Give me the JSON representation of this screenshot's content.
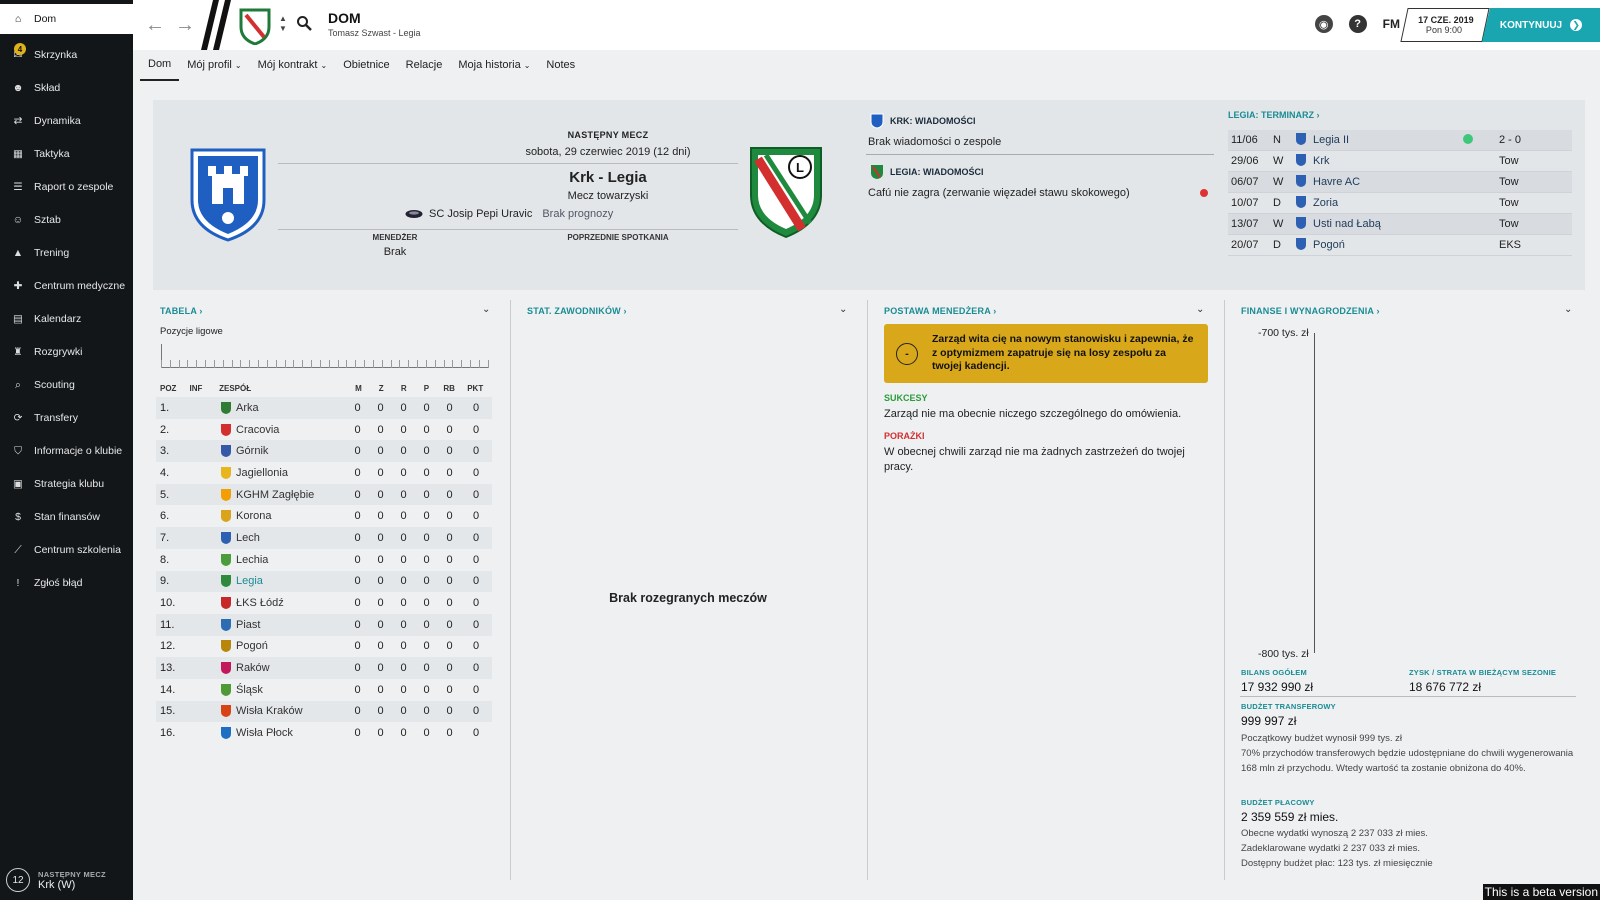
{
  "sidebar": {
    "items": [
      {
        "label": "Dom",
        "icon": "home-icon",
        "active": true
      },
      {
        "label": "Skrzynka",
        "icon": "inbox-icon",
        "badge": "4"
      },
      {
        "label": "Skład",
        "icon": "squad-icon"
      },
      {
        "label": "Dynamika",
        "icon": "dynamics-icon"
      },
      {
        "label": "Taktyka",
        "icon": "tactics-icon"
      },
      {
        "label": "Raport o zespole",
        "icon": "report-icon"
      },
      {
        "label": "Sztab",
        "icon": "staff-icon"
      },
      {
        "label": "Trening",
        "icon": "training-icon"
      },
      {
        "label": "Centrum medyczne",
        "icon": "medical-icon"
      },
      {
        "label": "Kalendarz",
        "icon": "calendar-icon"
      },
      {
        "label": "Rozgrywki",
        "icon": "trophy-icon"
      },
      {
        "label": "Scouting",
        "icon": "scouting-icon"
      },
      {
        "label": "Transfery",
        "icon": "transfers-icon"
      },
      {
        "label": "Informacje o klubie",
        "icon": "club-info-icon"
      },
      {
        "label": "Strategia klubu",
        "icon": "strategy-icon"
      },
      {
        "label": "Stan finansów",
        "icon": "finances-icon"
      },
      {
        "label": "Centrum szkolenia",
        "icon": "academy-icon"
      },
      {
        "label": "Zgłoś błąd",
        "icon": "bug-report-icon"
      }
    ],
    "next_match": {
      "label": "NASTĘPNY MECZ",
      "number": "12",
      "value": "Krk (W)"
    }
  },
  "header": {
    "title": "DOM",
    "subtitle": "Tomasz Szwast - Legia",
    "fm_label": "FM",
    "date": "17 CZE. 2019",
    "time": "Pon 9:00",
    "continue_label": "KONTYNUUJ"
  },
  "tabs": [
    {
      "label": "Dom",
      "active": true,
      "dropdown": false
    },
    {
      "label": "Mój profil",
      "dropdown": true
    },
    {
      "label": "Mój kontrakt",
      "dropdown": true
    },
    {
      "label": "Obietnice",
      "dropdown": false
    },
    {
      "label": "Relacje",
      "dropdown": false
    },
    {
      "label": "Moja historia",
      "dropdown": true
    },
    {
      "label": "Notes",
      "dropdown": false
    }
  ],
  "next_match": {
    "title": "NASTĘPNY MECZ",
    "date": "sobota, 29 czerwiec 2019 (12 dni)",
    "match": "Krk - Legia",
    "type": "Mecz towarzyski",
    "stadium": "SC Josip Pepi Uravic",
    "prognosis": "Brak prognozy",
    "manager_label": "MENEDŻER",
    "manager_value": "Brak",
    "previous_label": "POPRZEDNIE SPOTKANIA"
  },
  "news": {
    "krk_head": "KRK: WIADOMOŚCI",
    "krk_text": "Brak wiadomości o zespole",
    "legia_head": "LEGIA: WIADOMOŚCI",
    "legia_text": "Cafú nie zagra (zerwanie więzadeł stawu skokowego)"
  },
  "fixtures": {
    "head": "LEGIA: TERMINARZ",
    "rows": [
      {
        "date": "11/06",
        "ha": "N",
        "team": "Legia II",
        "result": "2 - 0",
        "dot": true
      },
      {
        "date": "29/06",
        "ha": "W",
        "team": "Krk",
        "result": "Tow"
      },
      {
        "date": "06/07",
        "ha": "W",
        "team": "Havre AC",
        "result": "Tow"
      },
      {
        "date": "10/07",
        "ha": "D",
        "team": "Zoria",
        "result": "Tow"
      },
      {
        "date": "13/07",
        "ha": "W",
        "team": "Usti nad Łabą",
        "result": "Tow"
      },
      {
        "date": "20/07",
        "ha": "D",
        "team": "Pogoń",
        "result": "EKS"
      }
    ]
  },
  "table_widget": {
    "head": "TABELA",
    "sub": "Pozycje ligowe",
    "columns": [
      "POZ",
      "INF",
      "ZESPÓŁ",
      "M",
      "Z",
      "R",
      "P",
      "RB",
      "PKT"
    ],
    "rows": [
      {
        "pos": "1.",
        "team": "Arka",
        "color": "#2f7d32"
      },
      {
        "pos": "2.",
        "team": "Cracovia",
        "color": "#d32f2f"
      },
      {
        "pos": "3.",
        "team": "Górnik",
        "color": "#3557a8"
      },
      {
        "pos": "4.",
        "team": "Jagiellonia",
        "color": "#e8b51c"
      },
      {
        "pos": "5.",
        "team": "KGHM Zagłębie",
        "color": "#f29f05"
      },
      {
        "pos": "6.",
        "team": "Korona",
        "color": "#d9a31a"
      },
      {
        "pos": "7.",
        "team": "Lech",
        "color": "#2d5fb3"
      },
      {
        "pos": "8.",
        "team": "Lechia",
        "color": "#4a9d3a"
      },
      {
        "pos": "9.",
        "team": "Legia",
        "color": "#2e8b3e",
        "highlight": true
      },
      {
        "pos": "10.",
        "team": "ŁKS Łódź",
        "color": "#c62828"
      },
      {
        "pos": "11.",
        "team": "Piast",
        "color": "#2b6cb3"
      },
      {
        "pos": "12.",
        "team": "Pogoń",
        "color": "#b8860b"
      },
      {
        "pos": "13.",
        "team": "Raków",
        "color": "#c2185b"
      },
      {
        "pos": "14.",
        "team": "Śląsk",
        "color": "#4f9a35"
      },
      {
        "pos": "15.",
        "team": "Wisła Kraków",
        "color": "#d84315"
      },
      {
        "pos": "16.",
        "team": "Wisła Płock",
        "color": "#1e6fc1"
      }
    ],
    "zero": "0"
  },
  "player_stats": {
    "head": "STAT. ZAWODNIKÓW",
    "empty": "Brak rozegranych meczów"
  },
  "manager_stance": {
    "head": "POSTAWA MENEDŻERA",
    "board_text": "Zarząd wita cię na nowym stanowisku i zapewnia, że z optymizmem zapatruje się na losy zespołu za twojej kadencji.",
    "mood_symbol": "-",
    "success_label": "SUKCESY",
    "success_text": "Zarząd nie ma obecnie niczego szczególnego do omówienia.",
    "fail_label": "PORAŻKI",
    "fail_text": "W obecnej chwili zarząd nie ma żadnych zastrzeżeń do twojej pracy."
  },
  "finances": {
    "head": "FINANSE I WYNAGRODZENIA",
    "axis_top": "-700 tys. zł",
    "axis_bottom": "-800 tys. zł",
    "balance_label": "BILANS OGÓŁEM",
    "balance_value": "17 932 990 zł",
    "profit_label": "ZYSK / STRATA W BIEŻĄCYM SEZONIE",
    "profit_value": "18 676 772 zł",
    "transfer_label": "BUDŻET TRANSFEROWY",
    "transfer_value": "999 997 zł",
    "transfer_note1": "Początkowy budżet wynosił 999 tys. zł",
    "transfer_note2": "70% przychodów transferowych będzie udostępniane do chwili wygenerowania 168 mln zł przychodu. Wtedy wartość ta zostanie obniżona do 40%.",
    "wage_label": "BUDŻET PŁACOWY",
    "wage_value": "2 359 559 zł mies.",
    "wage_note1": "Obecne wydatki wynoszą 2 237 033 zł mies.",
    "wage_note2": "Zadeklarowane wydatki 2 237 033 zł mies.",
    "wage_note3": "Dostępny budżet płac: 123 tys. zł miesięcznie"
  },
  "beta_label": "This is a beta version",
  "colors": {
    "accent": "#1aa6b1",
    "board": "#d9a81a",
    "sidebar": "#121619"
  }
}
